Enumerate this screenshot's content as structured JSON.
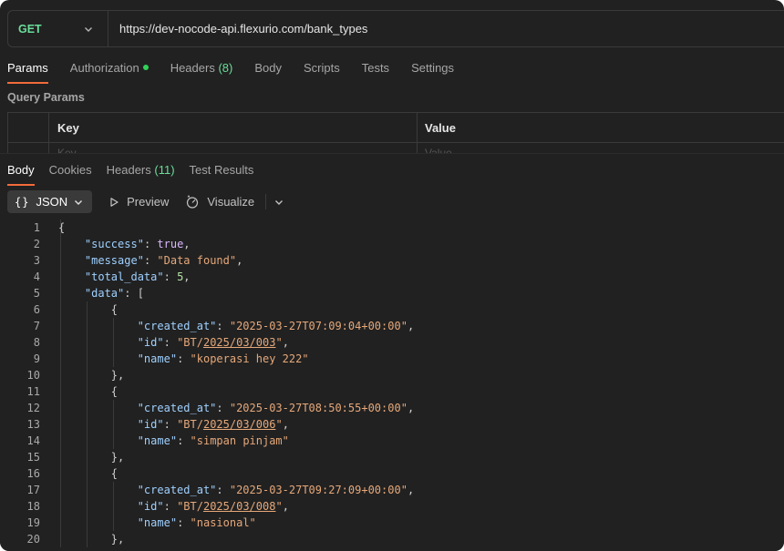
{
  "request": {
    "method": "GET",
    "url": "https://dev-nocode-api.flexurio.com/bank_types"
  },
  "request_tabs": [
    {
      "label": "Params",
      "active": true
    },
    {
      "label": "Authorization",
      "dot": true
    },
    {
      "label": "Headers",
      "count": "(8)"
    },
    {
      "label": "Body"
    },
    {
      "label": "Scripts"
    },
    {
      "label": "Tests"
    },
    {
      "label": "Settings"
    }
  ],
  "query_params": {
    "title": "Query Params",
    "key_header": "Key",
    "value_header": "Value",
    "key_placeholder": "Key",
    "value_placeholder": "Value"
  },
  "response_tabs": [
    {
      "label": "Body",
      "active": true
    },
    {
      "label": "Cookies"
    },
    {
      "label": "Headers",
      "count": "(11)"
    },
    {
      "label": "Test Results"
    }
  ],
  "toolbar": {
    "format_braces": "{}",
    "format": "JSON",
    "preview": "Preview",
    "visualize": "Visualize"
  },
  "code_lines": [
    [
      "1",
      "{"
    ],
    [
      "2",
      "    \"success\": true,"
    ],
    [
      "3",
      "    \"message\": \"Data found\","
    ],
    [
      "4",
      "    \"total_data\": 5,"
    ],
    [
      "5",
      "    \"data\": ["
    ],
    [
      "6",
      "        {"
    ],
    [
      "7",
      "            \"created_at\": \"2025-03-27T07:09:04+00:00\","
    ],
    [
      "8",
      "            \"id\": \"BT/2025/03/003\","
    ],
    [
      "9",
      "            \"name\": \"koperasi hey 222\""
    ],
    [
      "10",
      "        },"
    ],
    [
      "11",
      "        {"
    ],
    [
      "12",
      "            \"created_at\": \"2025-03-27T08:50:55+00:00\","
    ],
    [
      "13",
      "            \"id\": \"BT/2025/03/006\","
    ],
    [
      "14",
      "            \"name\": \"simpan pinjam\""
    ],
    [
      "15",
      "        },"
    ],
    [
      "16",
      "        {"
    ],
    [
      "17",
      "            \"created_at\": \"2025-03-27T09:27:09+00:00\","
    ],
    [
      "18",
      "            \"id\": \"BT/2025/03/008\","
    ],
    [
      "19",
      "            \"name\": \"nasional\""
    ],
    [
      "20",
      "        },"
    ]
  ],
  "colors": {
    "background": "#212121",
    "accent": "#f26b3a",
    "method_get": "#6bdd9a",
    "json_key": "#9fd0ff",
    "json_string": "#e6a87a",
    "json_boolean": "#dab7ff",
    "json_number": "#b5e3a6"
  }
}
